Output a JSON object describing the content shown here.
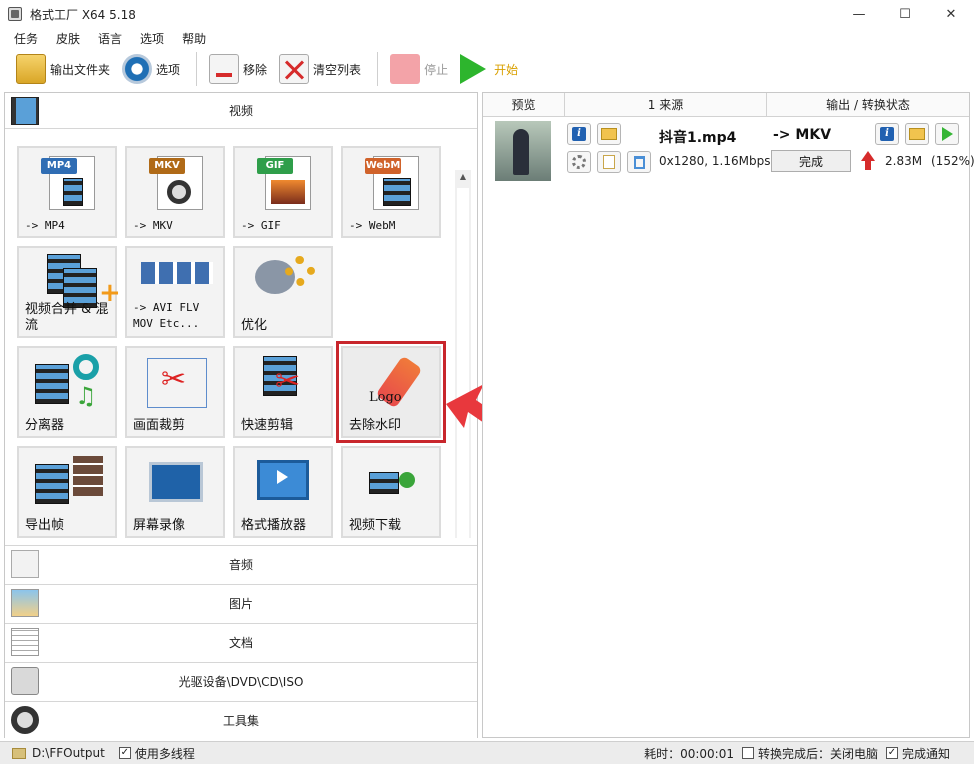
{
  "window": {
    "title": "格式工厂 X64 5.18",
    "controls": [
      "—",
      "☐",
      "✕"
    ]
  },
  "menu": [
    "任务",
    "皮肤",
    "语言",
    "选项",
    "帮助"
  ],
  "toolbar": {
    "output_folder": "输出文件夹",
    "options": "选项",
    "remove": "移除",
    "clear_list": "清空列表",
    "stop": "停止",
    "start": "开始"
  },
  "left": {
    "video_title": "视频",
    "tiles": [
      {
        "label": "-> MP4",
        "badge": "MP4",
        "badge_color": "#2f6db4"
      },
      {
        "label": "-> MKV",
        "badge": "MKV",
        "badge_color": "#b06a17"
      },
      {
        "label": "-> GIF",
        "badge": "GIF",
        "badge_color": "#2f9e4a"
      },
      {
        "label": "-> WebM",
        "badge": "WebM",
        "badge_color": "#d0622a"
      },
      {
        "label": "视频合并 & 混流"
      },
      {
        "label": "-> AVI FLV MOV Etc..."
      },
      {
        "label": "优化"
      },
      {
        "label": "分离器"
      },
      {
        "label": "画面裁剪"
      },
      {
        "label": "快速剪辑"
      },
      {
        "label": "去除水印",
        "logo_text": "Logo"
      },
      {
        "label": "导出帧"
      },
      {
        "label": "屏幕录像"
      },
      {
        "label": "格式播放器"
      },
      {
        "label": "视频下载"
      }
    ],
    "categories": [
      "音频",
      "图片",
      "文档",
      "光驱设备\\DVD\\CD\\ISO",
      "工具集"
    ]
  },
  "right": {
    "headers": [
      "预览",
      "1 来源",
      "输出 / 转换状态"
    ],
    "task": {
      "name": "抖音1.mp4",
      "target": "-> MKV",
      "meta": "0x1280, 1.16Mbps",
      "status": "完成",
      "size": "2.83M",
      "percent": "(152%)"
    }
  },
  "status": {
    "output_path": "D:\\FFOutput",
    "multithread": "使用多线程",
    "elapsed": "耗时：00:00:01",
    "after_done": "转换完成后：关闭电脑",
    "notify": "完成通知"
  },
  "colors": {
    "highlight": "#c8262c",
    "annotation_arrow": "#e8383d"
  }
}
